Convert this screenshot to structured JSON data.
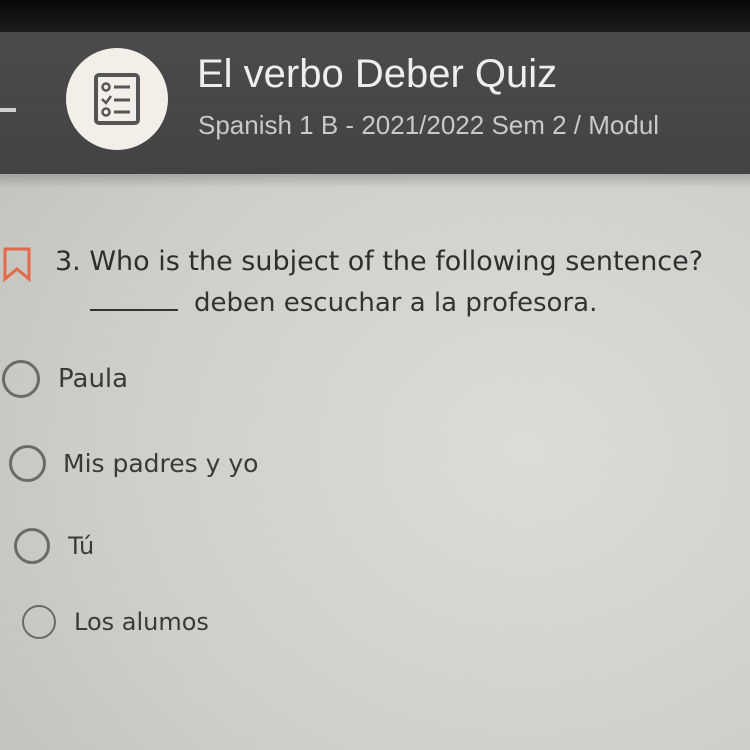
{
  "header": {
    "title": "El verbo Deber Quiz",
    "subtitle": "Spanish 1 B - 2021/2022 Sem 2 / Modul",
    "icon": "quiz-checklist-icon",
    "back_icon": "back-arrow-icon"
  },
  "question": {
    "number_and_text": "3. Who is the subject of the following sentence?",
    "sentence": "deben escuchar a la profesora.",
    "bookmark_icon": "bookmark-icon"
  },
  "options": [
    {
      "label": "Paula"
    },
    {
      "label": "Mis padres y yo"
    },
    {
      "label": "Tú"
    },
    {
      "label": "Los alumos"
    }
  ],
  "colors": {
    "header_bg": "#474747",
    "accent": "#e06a4a",
    "icon_circle": "#f3eee8"
  }
}
